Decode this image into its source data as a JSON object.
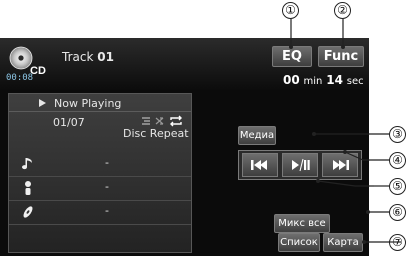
{
  "callouts": [
    "①",
    "②",
    "③",
    "④",
    "⑤",
    "⑥",
    "⑦"
  ],
  "source": {
    "icon": "cd-disc-icon",
    "label": "CD",
    "small_time": "00:08"
  },
  "header": {
    "track_prefix": "Track",
    "track_number": "01"
  },
  "buttons": {
    "eq": "EQ",
    "func": "Func",
    "media": "Медиа",
    "mix": "Микс все",
    "list": "Список",
    "map": "Карта"
  },
  "elapsed": {
    "minutes": "00",
    "min_unit": "min",
    "seconds": "14",
    "sec_unit": "sec"
  },
  "now_playing": {
    "title": "Now Playing",
    "track_count": "01/07",
    "mode_icons": [
      "list-icon",
      "shuffle-icon",
      "repeat-icon"
    ],
    "repeat_mode": "Disc Repeat",
    "rows": [
      {
        "icon": "music-note-icon",
        "value": "-"
      },
      {
        "icon": "artist-icon",
        "value": "-"
      },
      {
        "icon": "disc-album-icon",
        "value": "-"
      }
    ]
  },
  "controls": [
    "previous-track-icon",
    "play-pause-icon",
    "next-track-icon"
  ],
  "colors": {
    "screen_bg": "#0b0b0b",
    "button_gradient_top": "#6e6e6e",
    "button_gradient_bottom": "#3e3e3e",
    "time_blue": "#8cc6e6"
  }
}
